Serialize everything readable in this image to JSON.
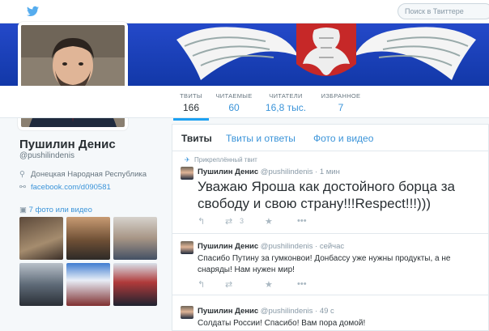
{
  "topbar": {
    "search_placeholder": "Поиск в Твиттере"
  },
  "stats": [
    {
      "label": "ТВИТЫ",
      "value": "166"
    },
    {
      "label": "ЧИТАЕМЫЕ",
      "value": "60"
    },
    {
      "label": "ЧИТАТЕЛИ",
      "value": "16,8 тыс."
    },
    {
      "label": "ИЗБРАННОЕ",
      "value": "7"
    }
  ],
  "profile": {
    "name": "Пушилин Денис",
    "handle": "@pushilindenis",
    "location": "Донецкая Народная Республика",
    "website": "facebook.com/d090581",
    "photos_link": "7 фото или видео"
  },
  "tabs": [
    "Твиты",
    "Твиты и ответы",
    "Фото и видео"
  ],
  "tweets": [
    {
      "pinned_label": "Прикреплённый твит",
      "name": "Пушилин Денис",
      "handle": "@pushilindenis",
      "time": "· 1 мин",
      "text": "Уважаю Яроша как достойного борца за свободу и свою страну!!!Respect!!!)))",
      "retweets": "3"
    },
    {
      "name": "Пушилин Денис",
      "handle": "@pushilindenis",
      "time": "· сейчас",
      "text": "Спасибо Путину за гумконвои! Донбассу уже нужны продукты, а не снаряды! Нам нужен мир!"
    },
    {
      "name": "Пушилин Денис",
      "handle": "@pushilindenis",
      "time": "· 49 с",
      "text": "Солдаты России! Спасибо! Вам пора домой!"
    }
  ],
  "colors": {
    "accent": "#3b94d9",
    "banner_blue": "#1a3fb5",
    "text": "#292f33",
    "muted": "#8899a6"
  },
  "icons": [
    "twitter-bird-icon",
    "location-pin-icon",
    "link-icon",
    "camera-icon",
    "pin-icon",
    "reply-icon",
    "retweet-icon",
    "favorite-icon",
    "more-icon"
  ]
}
